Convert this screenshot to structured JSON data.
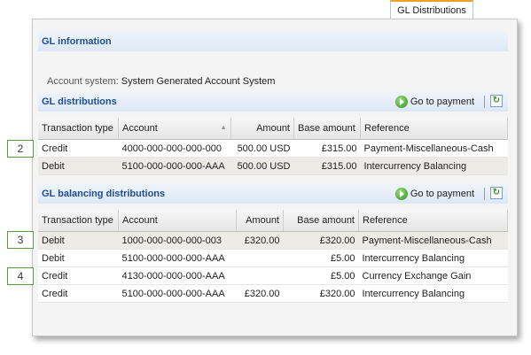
{
  "tab": {
    "label": "GL Distributions"
  },
  "gl_information": {
    "title": "GL information",
    "account_system_label": "Account system:",
    "account_system_value": "System Generated Account System"
  },
  "gl_distributions": {
    "title": "GL distributions",
    "go_to_payment": "Go to payment",
    "columns": [
      "Transaction type",
      "Account",
      "Amount",
      "Base amount",
      "Reference"
    ],
    "rows": [
      [
        "Credit",
        "4000-000-000-000-000",
        "500.00 USD",
        "£315.00",
        "Payment-Miscellaneous-Cash"
      ],
      [
        "Debit",
        "5100-000-000-000-AAA",
        "500.00 USD",
        "£315.00",
        "Intercurrency Balancing"
      ]
    ]
  },
  "gl_balancing": {
    "title": "GL balancing distributions",
    "go_to_payment": "Go to payment",
    "columns": [
      "Transaction type",
      "Account",
      "Amount",
      "Base amount",
      "Reference"
    ],
    "rows": [
      [
        "Debit",
        "1000-000-000-000-003",
        "£320.00",
        "£320.00",
        "Payment-Miscellaneous-Cash"
      ],
      [
        "Debit",
        "5100-000-000-000-AAA",
        "",
        "£5.00",
        "Intercurrency Balancing"
      ],
      [
        "Credit",
        "4130-000-000-000-AAA",
        "",
        "£5.00",
        "Currency Exchange Gain"
      ],
      [
        "Credit",
        "5100-000-000-000-AAA",
        "£320.00",
        "£320.00",
        "Intercurrency Balancing"
      ]
    ]
  },
  "callouts": [
    "2",
    "3",
    "4"
  ]
}
